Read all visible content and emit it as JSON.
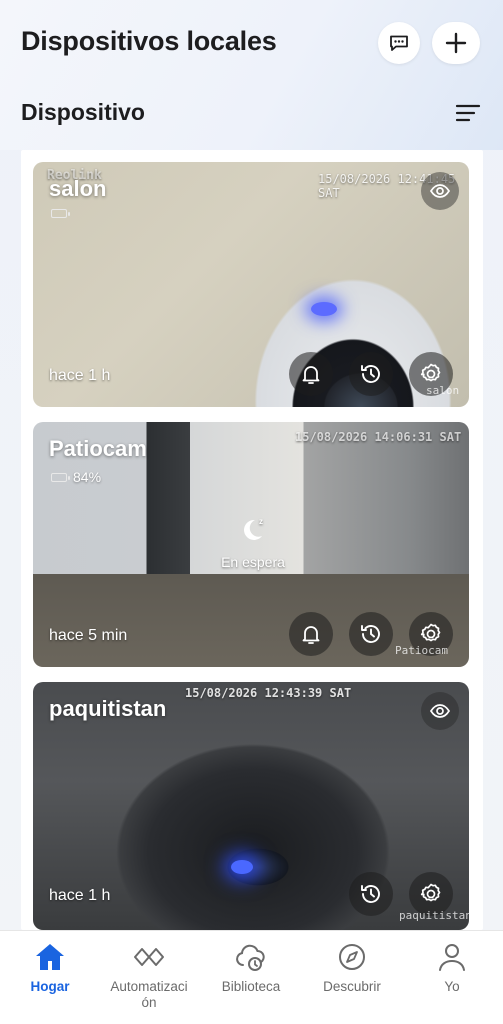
{
  "header": {
    "title": "Dispositivos locales",
    "section_title": "Dispositivo"
  },
  "devices": [
    {
      "name": "salon",
      "battery_text": "",
      "battery_level": 0.6,
      "timestamp": "15/08/2026 12:41:45 SAT",
      "brand_overlay": "Reolink",
      "last_seen": "hace 1 h",
      "watermark": "salon",
      "status": ""
    },
    {
      "name": "Patiocam",
      "battery_text": "84%",
      "battery_level": 0.84,
      "timestamp": "15/08/2026 14:06:31 SAT",
      "brand_overlay": "",
      "last_seen": "hace 5 min",
      "watermark": "Patiocam",
      "status": "En espera"
    },
    {
      "name": "paquitistan",
      "battery_text": "",
      "battery_level": null,
      "timestamp": "15/08/2026 12:43:39 SAT",
      "brand_overlay": "",
      "last_seen": "hace 1 h",
      "watermark": "paquitistan",
      "status": ""
    }
  ],
  "nav": {
    "items": [
      {
        "label": "Hogar",
        "icon": "home-icon",
        "active": true
      },
      {
        "label": "Automatizaci\nón",
        "icon": "automation-icon",
        "active": false
      },
      {
        "label": "Biblioteca",
        "icon": "cloud-clock-icon",
        "active": false
      },
      {
        "label": "Descubrir",
        "icon": "compass-icon",
        "active": false
      },
      {
        "label": "Yo",
        "icon": "user-icon",
        "active": false
      }
    ]
  },
  "colors": {
    "accent": "#1a64e0",
    "battery": "#3ad45a",
    "text": "#1d1d1f"
  }
}
